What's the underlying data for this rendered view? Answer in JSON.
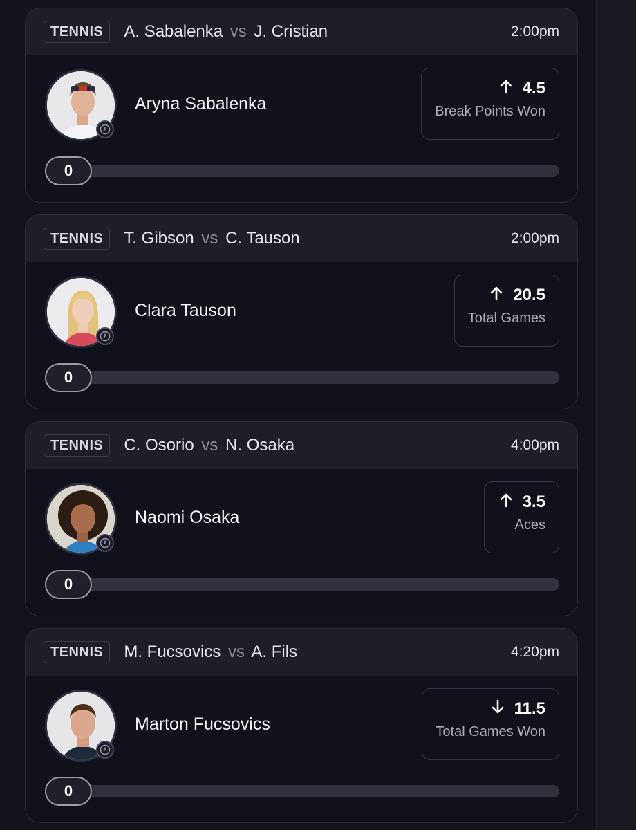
{
  "cards": [
    {
      "sport": "TENNIS",
      "player1": "A. Sabalenka",
      "vs": "vs",
      "player2": "J. Cristian",
      "time": "2:00pm",
      "player_name": "Aryna Sabalenka",
      "direction": "up",
      "line": "4.5",
      "stat": "Break Points Won",
      "progress": "0",
      "progress_fraction": 0,
      "avatar_icon": "player-photo-icon"
    },
    {
      "sport": "TENNIS",
      "player1": "T. Gibson",
      "vs": "vs",
      "player2": "C. Tauson",
      "time": "2:00pm",
      "player_name": "Clara Tauson",
      "direction": "up",
      "line": "20.5",
      "stat": "Total Games",
      "progress": "0",
      "progress_fraction": 0,
      "avatar_icon": "player-photo-icon"
    },
    {
      "sport": "TENNIS",
      "player1": "C. Osorio",
      "vs": "vs",
      "player2": "N. Osaka",
      "time": "4:00pm",
      "player_name": "Naomi Osaka",
      "direction": "up",
      "line": "3.5",
      "stat": "Aces",
      "progress": "0",
      "progress_fraction": 0,
      "avatar_icon": "player-photo-icon"
    },
    {
      "sport": "TENNIS",
      "player1": "M. Fucsovics",
      "vs": "vs",
      "player2": "A. Fils",
      "time": "4:20pm",
      "player_name": "Marton Fucsovics",
      "direction": "down",
      "line": "11.5",
      "stat": "Total Games Won",
      "progress": "0",
      "progress_fraction": 0,
      "avatar_icon": "player-photo-icon"
    }
  ],
  "colors": {
    "background": "#12131b",
    "card": "#10111a",
    "header": "#1d1e28",
    "track": "#30313d"
  }
}
